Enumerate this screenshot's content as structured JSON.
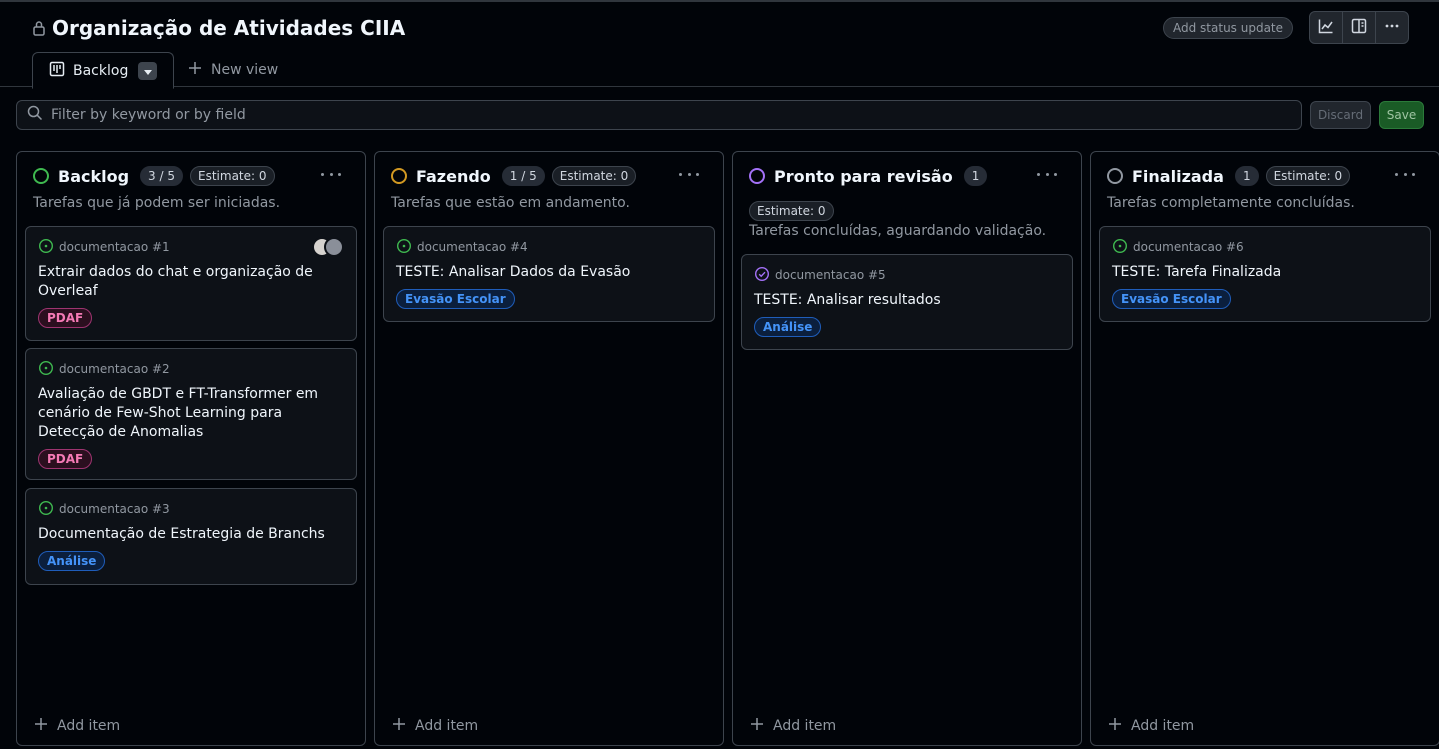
{
  "project": {
    "title": "Organização de Atividades CIIA",
    "status_button": "Add status update"
  },
  "tabs": [
    {
      "label": "Backlog",
      "active": true
    }
  ],
  "new_view_label": "New view",
  "filter": {
    "placeholder": "Filter by keyword or by field",
    "discard_label": "Discard",
    "save_label": "Save"
  },
  "add_item_label": "Add item",
  "columns": [
    {
      "name": "Backlog",
      "count": "3 / 5",
      "estimate": "Estimate: 0",
      "description": "Tarefas que já podem ser iniciadas.",
      "color": "#3fb950",
      "cards": [
        {
          "repo": "documentacao #1",
          "title": "Extrair dados do chat e organização de Overleaf",
          "label": "PDAF",
          "label_kind": "pdaf",
          "avatars": true
        },
        {
          "repo": "documentacao #2",
          "title": "Avaliação de GBDT e FT-Transformer em cenário de Few-Shot Learning para Detecção de Anomalias",
          "label": "PDAF",
          "label_kind": "pdaf"
        },
        {
          "repo": "documentacao #3",
          "title": "Documentação de Estrategia de Branchs",
          "label": "Análise",
          "label_kind": "blue"
        }
      ]
    },
    {
      "name": "Fazendo",
      "count": "1 / 5",
      "estimate": "Estimate: 0",
      "description": "Tarefas que estão em andamento.",
      "color": "#d29922",
      "cards": [
        {
          "repo": "documentacao #4",
          "title": "TESTE: Analisar Dados da Evasão",
          "label": "Evasão Escolar",
          "label_kind": "blue"
        }
      ]
    },
    {
      "name": "Pronto para revisão",
      "count": "1",
      "estimate": "Estimate: 0",
      "description": "Tarefas concluídas, aguardando validação.",
      "color": "#a371f7",
      "cards": [
        {
          "repo": "documentacao #5",
          "title": "TESTE: Analisar resultados",
          "label": "Análise",
          "label_kind": "blue",
          "state": "done"
        }
      ]
    },
    {
      "name": "Finalizada",
      "count": "1",
      "estimate": "Estimate: 0",
      "description": "Tarefas completamente concluídas.",
      "color": "#9198a1",
      "cards": [
        {
          "repo": "documentacao #6",
          "title": "TESTE: Tarefa Finalizada",
          "label": "Evasão Escolar",
          "label_kind": "blue"
        }
      ]
    }
  ]
}
